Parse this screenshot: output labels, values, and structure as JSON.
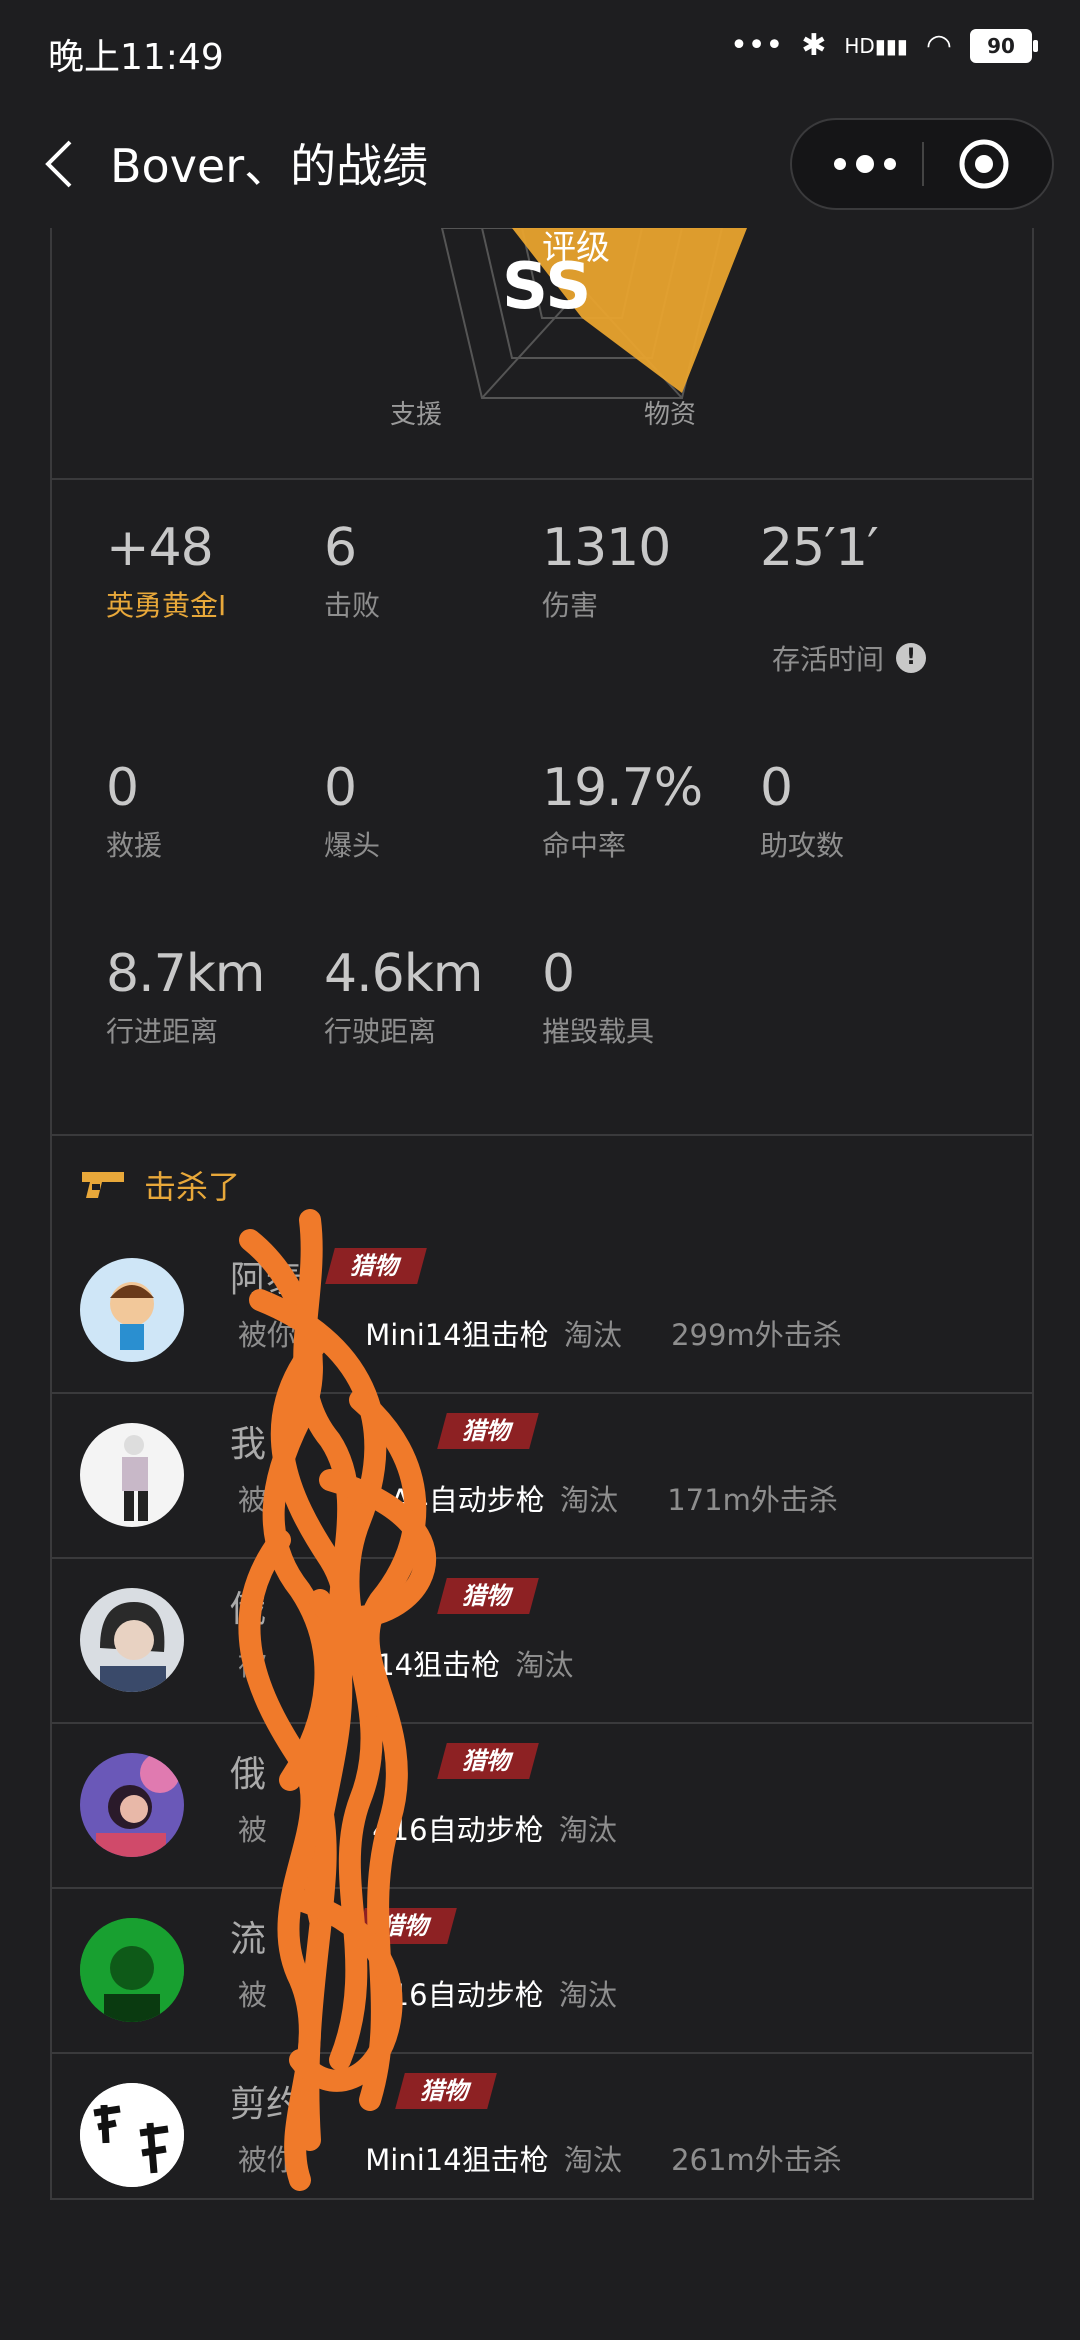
{
  "status": {
    "time": "晚上11:49",
    "battery": "90",
    "network": "HD"
  },
  "nav": {
    "title": "Bover、的战绩"
  },
  "rating": {
    "label": "评级",
    "grade": "SS",
    "axes": [
      "支援",
      "物资"
    ]
  },
  "stats": [
    {
      "value": "+48",
      "label": "英勇黄金Ⅰ"
    },
    {
      "value": "6",
      "label": "击败"
    },
    {
      "value": "1310",
      "label": "伤害"
    },
    {
      "value": "25′1′",
      "label": ""
    },
    {
      "value": "0",
      "label": "救援"
    },
    {
      "value": "0",
      "label": "爆头"
    },
    {
      "value": "19.7%",
      "label": "命中率"
    },
    {
      "value": "0",
      "label": "助攻数"
    },
    {
      "value": "8.7km",
      "label": "行进距离"
    },
    {
      "value": "4.6km",
      "label": "行驶距离"
    },
    {
      "value": "0",
      "label": "摧毁载具"
    }
  ],
  "survival_label": "存活时间",
  "kills": {
    "header": "击杀了",
    "badge": "猎物",
    "items": [
      {
        "name": "阿泰",
        "prefix": "被你",
        "weapon": "Mini14狙击枪",
        "result": "淘汰",
        "distance": "299m外击杀"
      },
      {
        "name": "我",
        "prefix": "被",
        "weapon": "M A4自动步枪",
        "result": "淘汰",
        "distance": "171m外击杀"
      },
      {
        "name": "俄",
        "prefix": "被",
        "weapon": "14狙击枪",
        "result": "淘汰",
        "distance": ""
      },
      {
        "name": "俄",
        "prefix": "被",
        "weapon": "416自动步枪",
        "result": "淘汰",
        "distance": ""
      },
      {
        "name": "流",
        "prefix": "被",
        "weapon": "416自动步枪",
        "result": "淘汰",
        "distance": ""
      },
      {
        "name": "剪约",
        "prefix": "被你",
        "weapon": "Mini14狙击枪",
        "result": "淘汰",
        "distance": "261m外击杀"
      }
    ]
  },
  "colors": {
    "accent": "#e8a83a",
    "badge": "#8d2123",
    "scribble": "#f07a2a",
    "background": "#1e1e20"
  }
}
